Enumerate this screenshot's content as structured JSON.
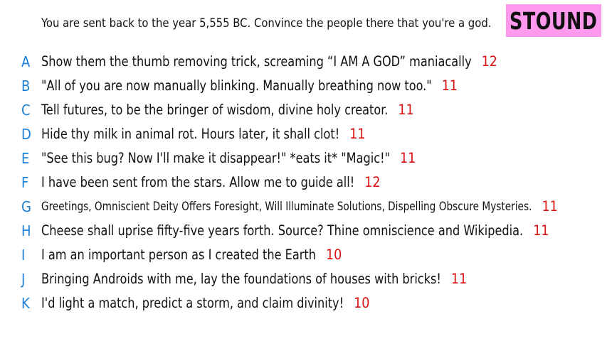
{
  "prompt": "You are sent back to the year 5,555 BC. Convince the people there that you're a god.",
  "logo": "STOUND",
  "colors": {
    "letter": "#1a7fd6",
    "score": "#dd1111",
    "logo_background": "#ff99ee"
  },
  "answers": [
    {
      "letter": "A",
      "text": "Show them the thumb removing trick, screaming “I AM A GOD” maniacally",
      "score": "12"
    },
    {
      "letter": "B",
      "text": "\"All of you are now manually blinking. Manually breathing now too.\"",
      "score": "11"
    },
    {
      "letter": "C",
      "text": "Tell futures, to be the bringer of wisdom, divine holy creator.",
      "score": "11"
    },
    {
      "letter": "D",
      "text": "Hide thy milk in animal rot. Hours later, it shall clot!",
      "score": "11"
    },
    {
      "letter": "E",
      "text": "\"See this bug? Now I'll make it disappear!\" *eats it* \"Magic!\"",
      "score": "11"
    },
    {
      "letter": "F",
      "text": "I have been sent from the stars. Allow me to guide all!",
      "score": "12"
    },
    {
      "letter": "G",
      "text": "Greetings, Omniscient Deity Offers Foresight, Will Illuminate Solutions, Dispelling Obscure Mysteries.",
      "score": "11"
    },
    {
      "letter": "H",
      "text": "Cheese shall uprise fifty-five years forth. Source? Thine omniscience and Wikipedia.",
      "score": "11"
    },
    {
      "letter": "I",
      "text": "I am an important person as I created the Earth",
      "score": "10"
    },
    {
      "letter": "J",
      "text": "Bringing Androids with me, lay the foundations of houses with bricks!",
      "score": "11"
    },
    {
      "letter": "K",
      "text": "I'd light a match, predict a storm, and claim divinity!",
      "score": "10"
    }
  ]
}
